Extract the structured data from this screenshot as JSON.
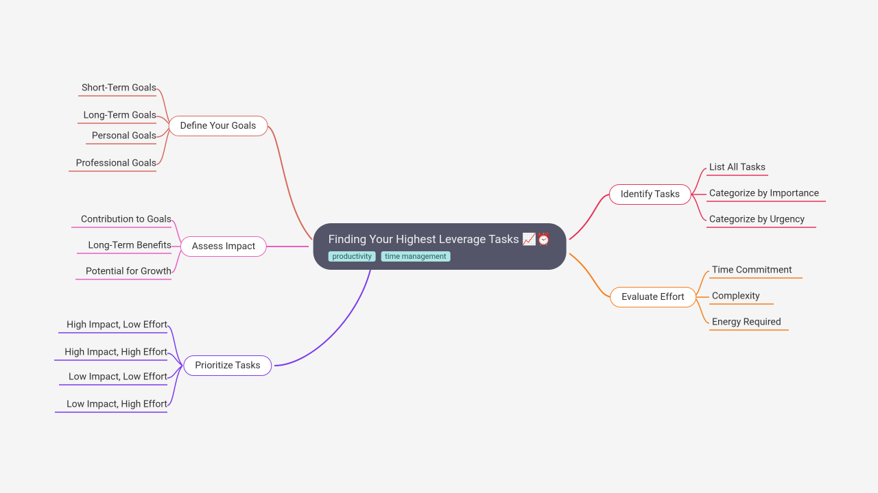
{
  "center": {
    "title": "Finding Your Highest Leverage Tasks 📈⏰",
    "tags": [
      "productivity",
      "time management"
    ]
  },
  "branches": {
    "defineGoals": {
      "label": "Define Your Goals",
      "color": "#d66a5e",
      "leaves": [
        "Short-Term Goals",
        "Long-Term Goals",
        "Personal Goals",
        "Professional Goals"
      ]
    },
    "assessImpact": {
      "label": "Assess Impact",
      "color": "#e85fc0",
      "leaves": [
        "Contribution to Goals",
        "Long-Term Benefits",
        "Potential for Growth"
      ]
    },
    "prioritizeTasks": {
      "label": "Prioritize Tasks",
      "color": "#7c3aed",
      "leaves": [
        "High Impact, Low Effort",
        "High Impact, High Effort",
        "Low Impact, Low Effort",
        "Low Impact, High Effort"
      ]
    },
    "identifyTasks": {
      "label": "Identify Tasks",
      "color": "#e6335a",
      "leaves": [
        "List All Tasks",
        "Categorize by Importance",
        "Categorize by Urgency"
      ]
    },
    "evaluateEffort": {
      "label": "Evaluate Effort",
      "color": "#f77e1a",
      "leaves": [
        "Time Commitment",
        "Complexity",
        "Energy Required"
      ]
    }
  }
}
